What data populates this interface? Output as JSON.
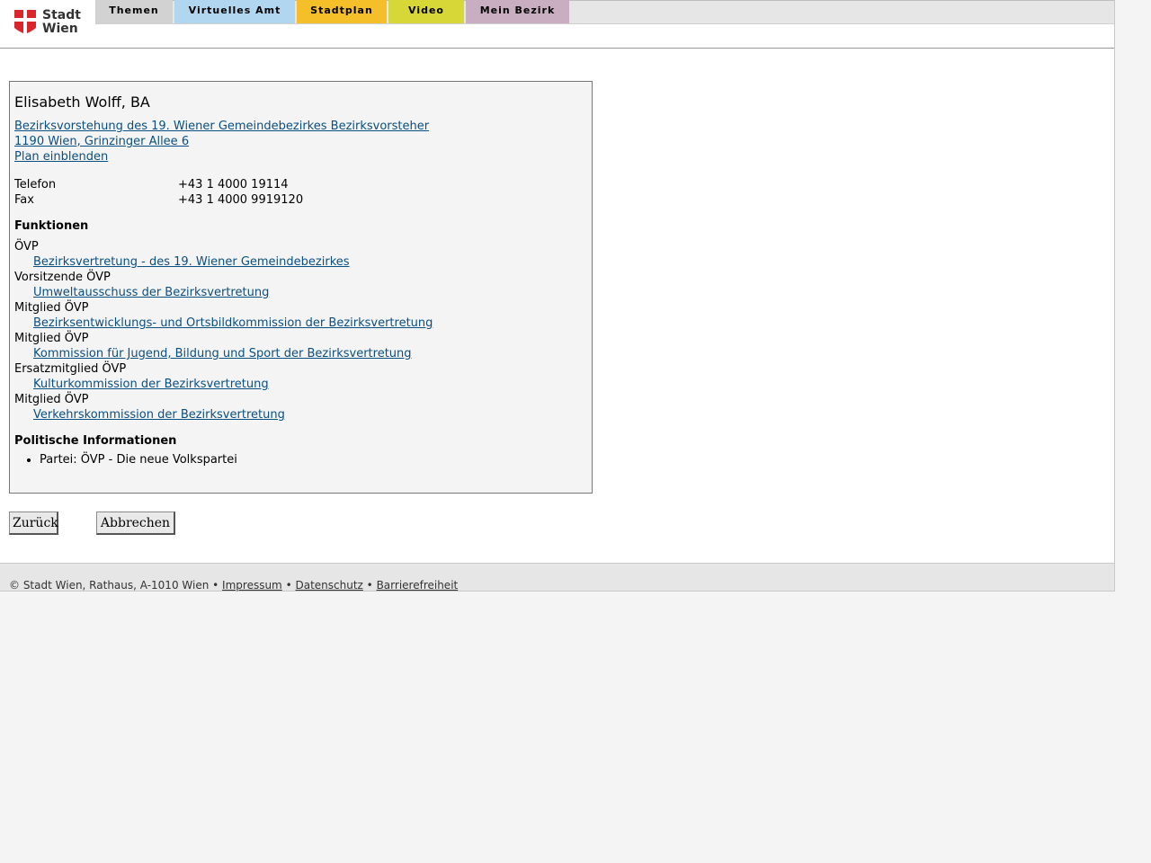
{
  "header": {
    "logo_text_1": "Stadt",
    "logo_text_2": "Wien",
    "tabs": [
      {
        "label": "Themen",
        "color": "#d2d2d2"
      },
      {
        "label": "Virtuelles Amt",
        "color": "#b0d7ef"
      },
      {
        "label": "Stadtplan",
        "color": "#f4bf28"
      },
      {
        "label": "Video",
        "color": "#d7d837"
      },
      {
        "label": "Mein Bezirk",
        "color": "#c9adc1"
      }
    ]
  },
  "person": {
    "name": "Elisabeth Wolff, BA",
    "office_link": "Bezirksvorstehung des 19. Wiener Gemeindebezirkes Bezirksvorsteher",
    "address_link": "1190 Wien, Grinzinger Allee 6",
    "map_link": "Plan einblenden",
    "phone_label": "Telefon",
    "phone_value": "+43 1 4000 19114",
    "fax_label": "Fax",
    "fax_value": "+43 1 4000 9919120"
  },
  "functions": {
    "heading": "Funktionen",
    "items": [
      {
        "role": "ÖVP",
        "body": "Bezirksvertretung - des 19. Wiener Gemeindebezirkes"
      },
      {
        "role": "Vorsitzende ÖVP",
        "body": "Umweltausschuss der Bezirksvertretung"
      },
      {
        "role": "Mitglied ÖVP",
        "body": "Bezirksentwicklungs- und Ortsbildkommission der Bezirksvertretung"
      },
      {
        "role": "Mitglied ÖVP",
        "body": "Kommission für Jugend, Bildung und Sport der Bezirksvertretung"
      },
      {
        "role": "Ersatzmitglied ÖVP",
        "body": "Kulturkommission der Bezirksvertretung"
      },
      {
        "role": "Mitglied ÖVP",
        "body": "Verkehrskommission der Bezirksvertretung"
      }
    ]
  },
  "political": {
    "heading": "Politische Informationen",
    "party": "Partei: ÖVP - Die neue Volkspartei"
  },
  "buttons": {
    "back": "Zurück",
    "cancel": "Abbrechen"
  },
  "footer": {
    "copyright": "© Stadt Wien, Rathaus, A-1010 Wien",
    "sep": "•",
    "impressum": "Impressum",
    "datenschutz": "Datenschutz",
    "barrierefreiheit": "Barrierefreiheit"
  }
}
